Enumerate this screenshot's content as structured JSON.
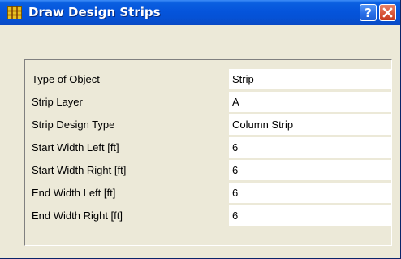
{
  "window": {
    "title": "Draw Design Strips",
    "icon": "grid-icon",
    "help_glyph": "?",
    "close_glyph": "X",
    "colors": {
      "titlebar": "#0554db",
      "background": "#ece9d8",
      "close_button": "#d9573a"
    }
  },
  "properties": [
    {
      "label": "Type of Object",
      "value": "Strip"
    },
    {
      "label": "Strip Layer",
      "value": "A"
    },
    {
      "label": "Strip Design Type",
      "value": "Column Strip"
    },
    {
      "label": "Start Width Left  [ft]",
      "value": "6"
    },
    {
      "label": "Start Width Right  [ft]",
      "value": "6"
    },
    {
      "label": "End Width Left  [ft]",
      "value": "6"
    },
    {
      "label": "End Width Right  [ft]",
      "value": "6"
    }
  ]
}
